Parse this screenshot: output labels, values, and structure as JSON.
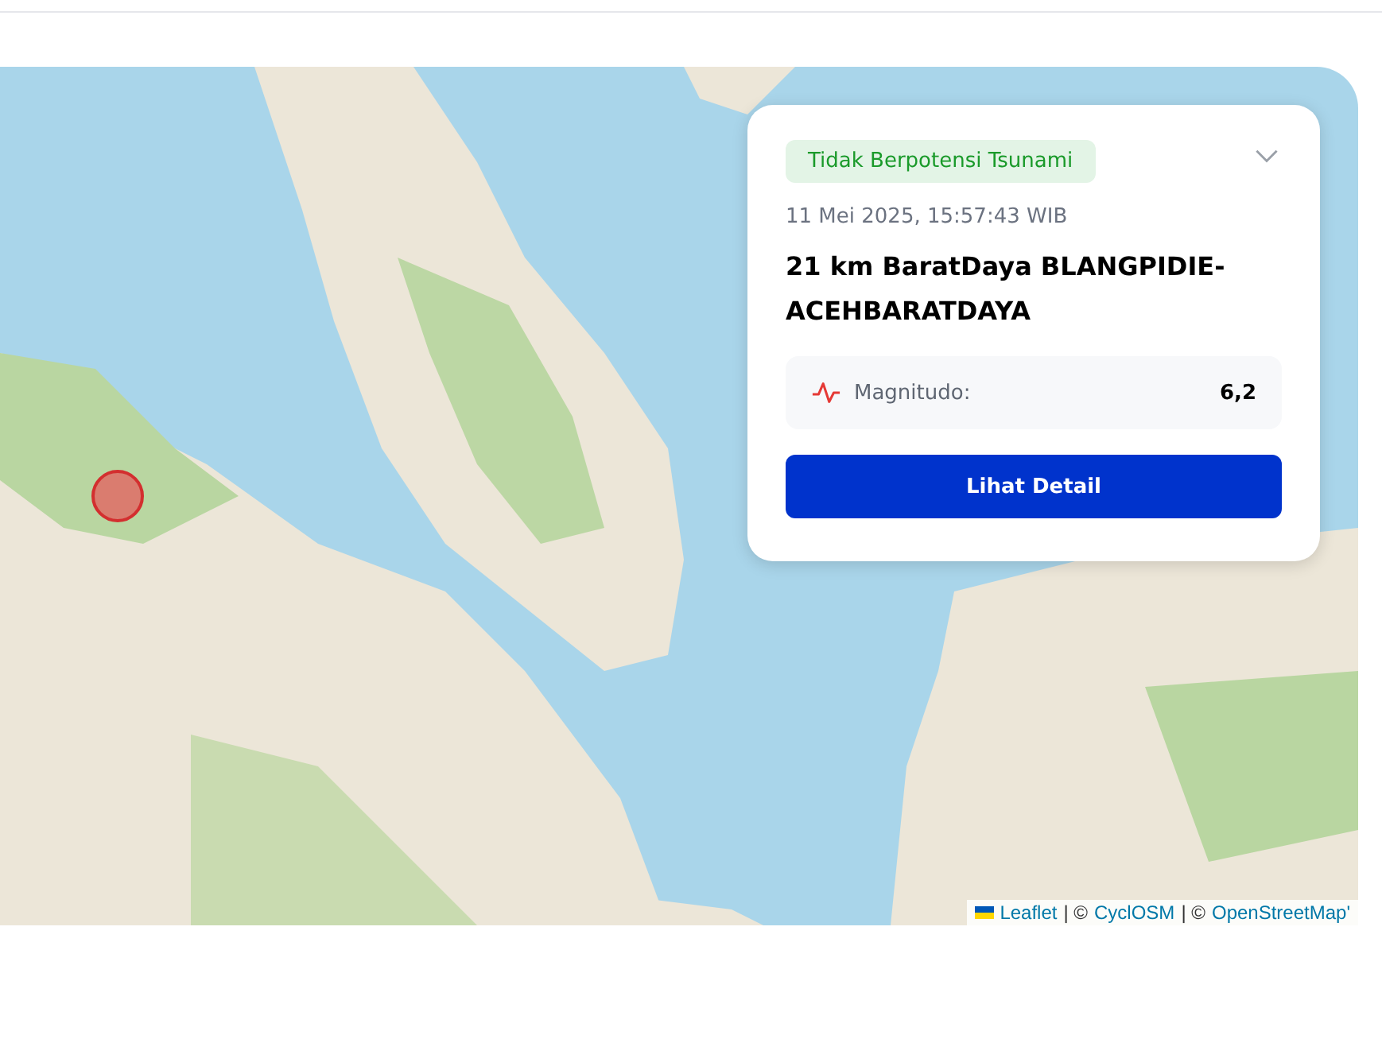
{
  "earthquake_card": {
    "tsunami_badge": {
      "label": "Tidak Berpotensi Tsunami",
      "kind": "none"
    },
    "datetime": "11 Mei 2025, 15:57:43 WIB",
    "location": "21 km BaratDaya BLANGPIDIE-ACEHBARATDAYA",
    "magnitude": {
      "label": "Magnitudo:",
      "value": "6,2"
    },
    "detail_button": "Lihat Detail"
  },
  "attribution": [
    {
      "text": "Leaflet",
      "kind": "link"
    },
    {
      "text": "| ©",
      "kind": "plain"
    },
    {
      "text": "CyclOSM",
      "kind": "link"
    },
    {
      "text": "| ©",
      "kind": "plain"
    },
    {
      "text": "OpenStreetMap'",
      "kind": "link"
    }
  ]
}
